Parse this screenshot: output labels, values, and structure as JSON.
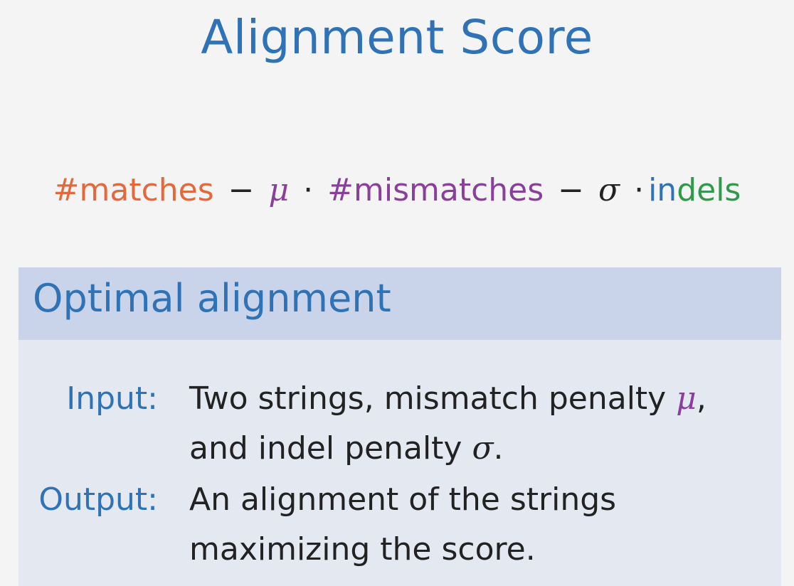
{
  "slide": {
    "title": "Alignment Score"
  },
  "formula": {
    "matches": "#matches",
    "minus_1": "−",
    "mu": "μ",
    "dot_1": "·",
    "mismatches": "#mismatches",
    "minus_2": "−",
    "sigma": "σ",
    "dot_2": "·",
    "indels_in": "in",
    "indels_rest": "dels"
  },
  "colors": {
    "title": "#2f73b6",
    "matches": "#e4683a",
    "mismatches": "#8a3f9a",
    "indels_blue": "#2f73b6",
    "indels_green": "#2e9a4a",
    "block_header": "#c9d4ea",
    "block_body": "#e3e8f1"
  },
  "block": {
    "title": "Optimal alignment",
    "input_label": "Input:",
    "input_text_1": "Two strings, mismatch penalty ",
    "input_mu": "μ",
    "input_text_2": ",",
    "input_text_3": "and indel penalty ",
    "input_sigma": "σ",
    "input_text_4": ".",
    "output_label": "Output:",
    "output_text_1": "An alignment of the strings",
    "output_text_2": "maximizing the score."
  }
}
